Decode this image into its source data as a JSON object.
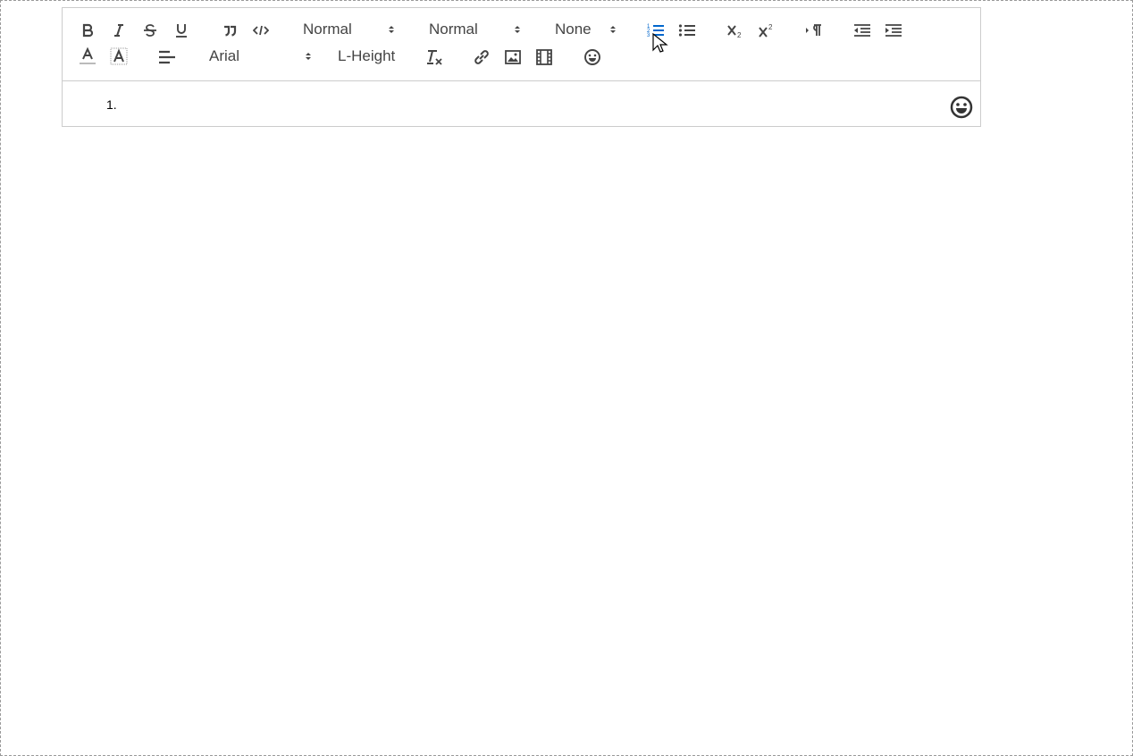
{
  "colors": {
    "icon": "#444444",
    "active": "#0066cc",
    "border": "#cccccc"
  },
  "toolbar": {
    "row1": {
      "buttons": [
        "bold-icon",
        "italic-icon",
        "strike-icon",
        "underline-icon",
        "blockquote-icon",
        "code-block-icon"
      ],
      "header_picker": "Normal",
      "size_picker": "Normal",
      "font_weight_picker": "None",
      "list_buttons": [
        "ordered-list-icon",
        "bullet-list-icon"
      ],
      "script_buttons": [
        "subscript-icon",
        "superscript-icon"
      ],
      "direction_button": "rtl-direction-icon",
      "indent_buttons": [
        "outdent-icon",
        "indent-icon"
      ]
    },
    "row2": {
      "buttons": [
        "font-color-icon",
        "background-color-icon",
        "align-left-icon"
      ],
      "font_picker": "Arial",
      "line_height_picker": "L-Height",
      "misc_buttons": [
        "clean-format-icon",
        "link-icon",
        "image-icon",
        "video-icon",
        "emoji-icon"
      ]
    },
    "active_button": "ordered-list-icon"
  },
  "editor": {
    "list_marker": "1."
  }
}
